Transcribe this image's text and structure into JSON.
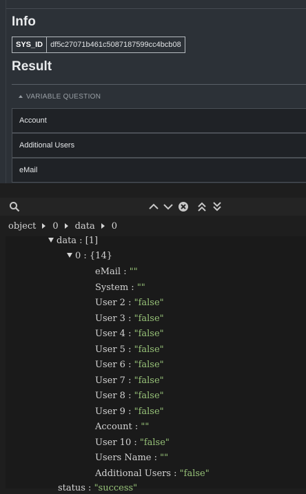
{
  "info": {
    "title": "Info",
    "sys_id_label": "SYS_ID",
    "sys_id_value": "df5c27071b461c5087187599cc4bcb08"
  },
  "result": {
    "title": "Result",
    "section_title": "VARIABLE QUESTION",
    "rows": [
      "Account",
      "Additional Users",
      "eMail"
    ]
  },
  "devtools": {
    "breadcrumb": [
      "object",
      "0",
      "data",
      "0"
    ],
    "tree": {
      "data_label": "data : [1]",
      "item_label": "0 : {14}",
      "fields": [
        {
          "key": "eMail : ",
          "value": "\"\""
        },
        {
          "key": "System : ",
          "value": "\"\""
        },
        {
          "key": "User 2 : ",
          "value": "\"false\""
        },
        {
          "key": "User 3 : ",
          "value": "\"false\""
        },
        {
          "key": "User 4 : ",
          "value": "\"false\""
        },
        {
          "key": "User 5 : ",
          "value": "\"false\""
        },
        {
          "key": "User 6 : ",
          "value": "\"false\""
        },
        {
          "key": "User 7 : ",
          "value": "\"false\""
        },
        {
          "key": "User 8 : ",
          "value": "\"false\""
        },
        {
          "key": "User 9 : ",
          "value": "\"false\""
        },
        {
          "key": "Account : ",
          "value": "\"\""
        },
        {
          "key": "User 10 : ",
          "value": "\"false\""
        },
        {
          "key": "Users Name : ",
          "value": "\"\""
        },
        {
          "key": "Additional Users : ",
          "value": "\"false\""
        }
      ],
      "status_key": "status : ",
      "status_value": "\"success\""
    }
  }
}
